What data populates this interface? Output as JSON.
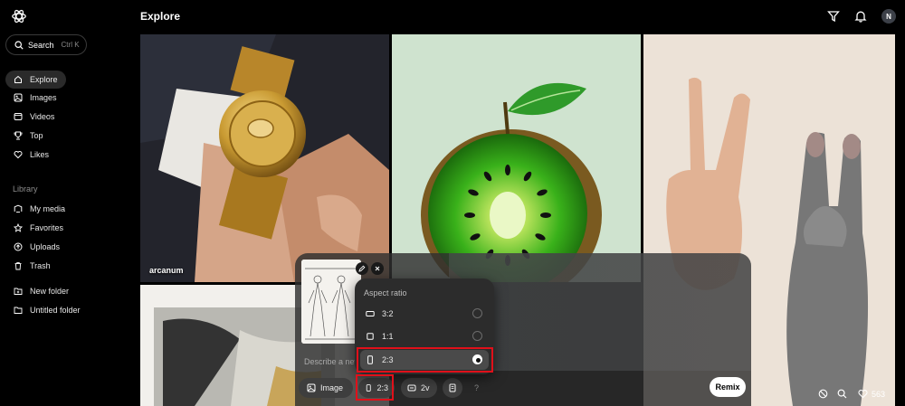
{
  "header": {
    "title": "Explore"
  },
  "search": {
    "label": "Search",
    "shortcut": "Ctrl K"
  },
  "sidebar": {
    "nav": [
      {
        "label": "Explore",
        "icon": "compass-icon",
        "active": true
      },
      {
        "label": "Images",
        "icon": "image-icon"
      },
      {
        "label": "Videos",
        "icon": "video-icon"
      },
      {
        "label": "Top",
        "icon": "trophy-icon"
      },
      {
        "label": "Likes",
        "icon": "heart-icon"
      }
    ],
    "library_label": "Library",
    "library": [
      {
        "label": "My media",
        "icon": "media-icon"
      },
      {
        "label": "Favorites",
        "icon": "star-icon"
      },
      {
        "label": "Uploads",
        "icon": "upload-icon"
      },
      {
        "label": "Trash",
        "icon": "trash-icon"
      }
    ],
    "folders": [
      {
        "label": "New folder",
        "icon": "new-folder-icon"
      },
      {
        "label": "Untitled folder",
        "icon": "folder-icon"
      }
    ]
  },
  "user": {
    "initial": "N"
  },
  "gallery": {
    "tiles": [
      {
        "label": "arcanum",
        "subject": "gold watch on wrist"
      },
      {
        "label": "",
        "subject": "glass kiwi apple"
      },
      {
        "label": "",
        "subject": "peace sign hand and cat paw"
      },
      {
        "label": "",
        "subject": "abstract painting"
      }
    ],
    "likes": "563"
  },
  "composer": {
    "prompt_placeholder": "Describe a new",
    "mode_label": "Image",
    "aspect_label": "2:3",
    "variants_label": "2v",
    "help_label": "?",
    "remix_label": "Remix"
  },
  "aspect_popover": {
    "title": "Aspect ratio",
    "options": [
      {
        "label": "3:2",
        "selected": false
      },
      {
        "label": "1:1",
        "selected": false
      },
      {
        "label": "2:3",
        "selected": true
      }
    ]
  },
  "colors": {
    "highlight": "#e0101a",
    "background": "#000000",
    "kiwi_green": "#2fa81a"
  }
}
